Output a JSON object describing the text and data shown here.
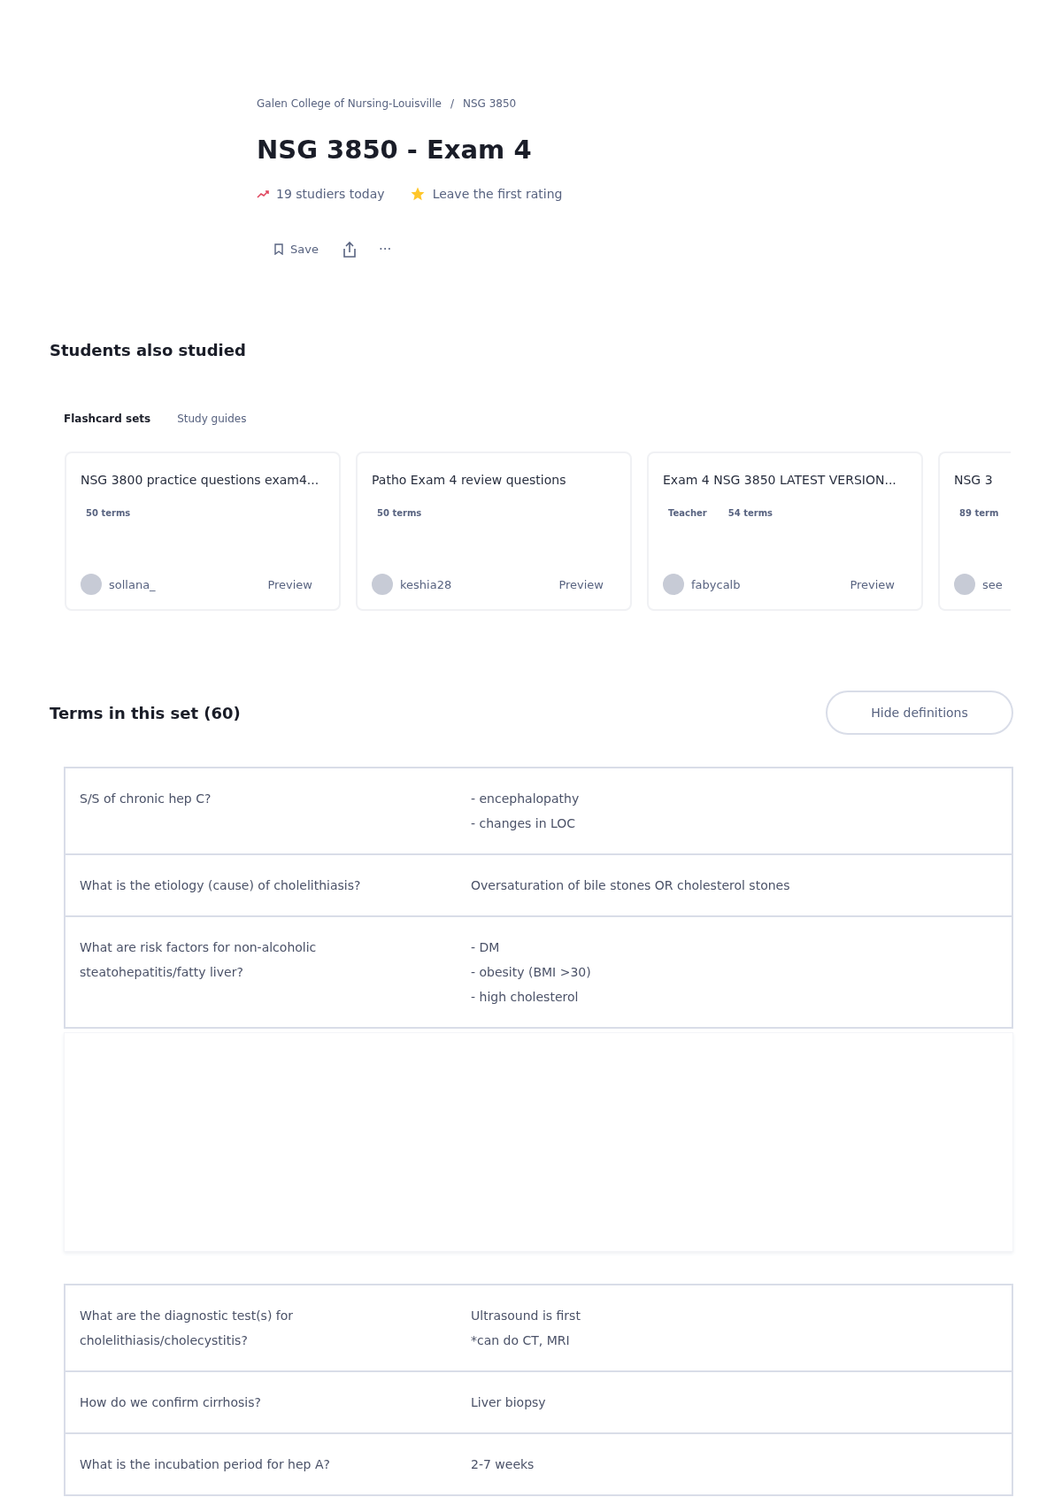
{
  "breadcrumb": [
    "Galen College of Nursing-Louisville",
    "NSG 3850"
  ],
  "breadcrumb_separator": "/",
  "title": "NSG 3850 - Exam 4",
  "stats": {
    "studiers": "19 studiers today",
    "rating": "Leave the first rating"
  },
  "actions": {
    "save": "Save",
    "more": "···"
  },
  "also_studied": {
    "heading": "Students also studied",
    "tabs": [
      {
        "label": "Flashcard sets",
        "selected": true
      },
      {
        "label": "Study guides",
        "selected": false
      }
    ],
    "cards": [
      {
        "title": "NSG 3800 practice questions exam4...",
        "badges": [
          "50 terms"
        ],
        "user": "sollana_",
        "preview": "Preview"
      },
      {
        "title": "Patho Exam 4 review questions",
        "badges": [
          "50 terms"
        ],
        "user": "keshia28",
        "preview": "Preview"
      },
      {
        "title": "Exam 4 NSG 3850 LATEST VERSION...",
        "badges": [
          "Teacher",
          "54 terms"
        ],
        "user": "fabycalb",
        "preview": "Preview"
      },
      {
        "title": "NSG 3",
        "badges": [
          "89 term"
        ],
        "user": "see"
      }
    ]
  },
  "terms": {
    "heading": "Terms in this set (60)",
    "hide_button": "Hide definitions",
    "groups": [
      [
        {
          "term": [
            "S/S of chronic hep C?"
          ],
          "definition": [
            "- encephalopathy",
            "- changes in LOC"
          ]
        },
        {
          "term": [
            "What is the etiology (cause) of cholelithiasis?"
          ],
          "definition": [
            "Oversaturation of bile stones OR cholesterol stones"
          ]
        },
        {
          "term": [
            "What are risk factors for non-alcoholic",
            "steatohepatitis/fatty liver?"
          ],
          "definition": [
            "- DM",
            "- obesity (BMI >30)",
            "- high cholesterol"
          ]
        }
      ],
      [
        {
          "term": [
            "What are the diagnostic test(s) for",
            "cholelithiasis/cholecystitis?"
          ],
          "definition": [
            "Ultrasound is first",
            "*can do CT, MRI"
          ]
        },
        {
          "term": [
            "How do we confirm cirrhosis?"
          ],
          "definition": [
            "Liver biopsy"
          ]
        },
        {
          "term": [
            "What is the incubation period for hep A?"
          ],
          "definition": [
            "2-7 weeks"
          ]
        }
      ]
    ]
  }
}
